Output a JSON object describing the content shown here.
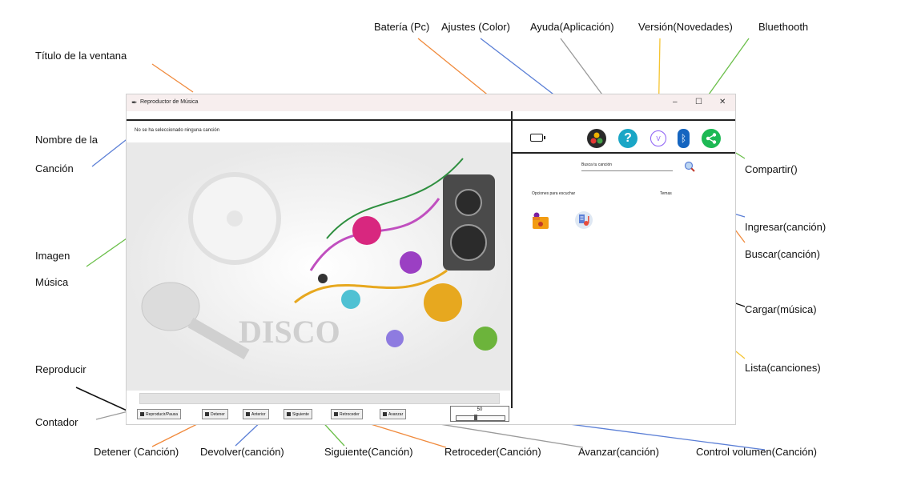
{
  "annotations": {
    "window_title": "Título de la ventana",
    "song_name_1": "Nombre de la",
    "song_name_2": "Canción",
    "image_1": "Imagen",
    "image_2": "Música",
    "play": "Reproducir",
    "counter": "Contador",
    "stop": "Detener (Canción)",
    "previous": "Devolver(canción)",
    "next": "Siguiente(Canción)",
    "rewind": "Retroceder(Canción)",
    "forward": "Avanzar(canción)",
    "volume": "Control volumen(Canción)",
    "battery": "Batería (Pc)",
    "settings": "Ajustes (Color)",
    "help": "Ayuda(Aplicación)",
    "version": "Versión(Novedades)",
    "bluetooth": "Bluethooth",
    "share": "Compartir()",
    "input": "Ingresar(canción)",
    "search": "Buscar(canción)",
    "load": "Cargar(música)",
    "list": "Lista(canciones)"
  },
  "window": {
    "title": "Reproductor de Música",
    "minimize": "–",
    "maximize": "☐",
    "close": "✕"
  },
  "player": {
    "song_label": "No se ha seleccionado ninguna canción",
    "buttons": {
      "play_pause": "Reproducir/Pausa",
      "stop": "Detener",
      "previous": "Anterior",
      "next": "Siguiente",
      "rewind": "Retroceder",
      "forward": "Avanzar"
    },
    "volume": {
      "value": "50"
    }
  },
  "right_panel": {
    "search_placeholder": "Busca tu canción",
    "options_label": "Opciones para escuchar",
    "themes_label": "Temas",
    "help_glyph": "?",
    "version_glyph": "V",
    "bluetooth_glyph": "ᛒ"
  },
  "colors": {
    "arrow_orange": "#f08a3c",
    "arrow_blue": "#5b7fd6",
    "arrow_green": "#6bbf4a",
    "arrow_yellow": "#f5c431",
    "arrow_gray": "#9a9a9a",
    "arrow_black": "#111111",
    "help_teal": "#1aa6c6",
    "share_green": "#1db954",
    "bluetooth_blue": "#1565c0",
    "version_purple": "#8a5cf5"
  }
}
